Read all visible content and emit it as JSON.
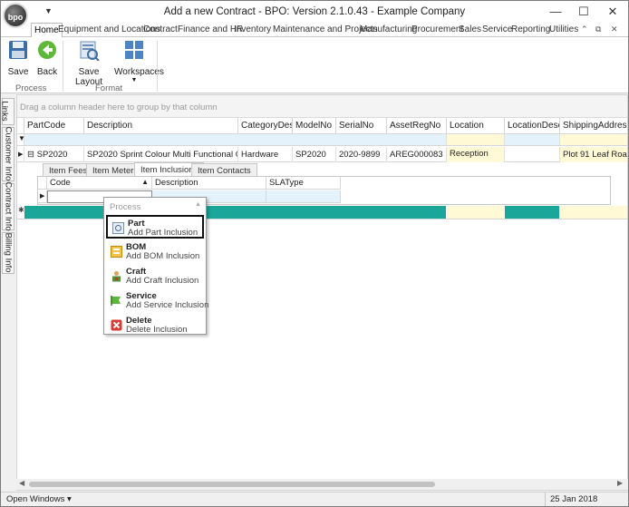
{
  "window": {
    "title": "Add a new Contract - BPO: Version 2.1.0.43 - Example Company",
    "logo_text": "bpo",
    "minimize": "—",
    "maximize": "☐",
    "close": "✕"
  },
  "menu": {
    "tabs": [
      "Home",
      "Equipment and Locations",
      "Contract",
      "Finance and HR",
      "Inventory",
      "Maintenance and Projects",
      "Manufacturing",
      "Procurement",
      "Sales",
      "Service",
      "Reporting",
      "Utilities"
    ],
    "active": "Home"
  },
  "ribbon": {
    "save": "Save",
    "back": "Back",
    "save_layout": "Save Layout",
    "workspaces": "Workspaces",
    "group_process": "Process",
    "group_format": "Format"
  },
  "side_tabs": [
    "Links",
    "Customer Info",
    "Contract Info",
    "Billing Info"
  ],
  "grid": {
    "group_hint": "Drag a column header here to group by that column",
    "columns": [
      "PartCode",
      "Description",
      "CategoryDesc",
      "ModelNo",
      "SerialNo",
      "AssetRegNo",
      "Location",
      "LocationDesc",
      "ShippingAddress"
    ],
    "row": {
      "expander": "⊟",
      "partcode": "SP2020",
      "description": "SP2020 Sprint Colour Multi Functional Copier",
      "category": "Hardware",
      "model": "SP2020",
      "serial": "2020-9899",
      "asset": "AREG000083",
      "location": "Reception",
      "location_desc": "",
      "shipping": "Plot 91 Leaf Road, Fo"
    }
  },
  "detail": {
    "tabs": [
      "Item Fees",
      "Item Meters",
      "Item Inclusions",
      "Item Contacts"
    ],
    "active_tab": "Item Inclusions",
    "columns": [
      "Code",
      "Description",
      "SLAType"
    ]
  },
  "context_menu": {
    "header": "Process",
    "items": [
      {
        "title": "Part",
        "subtitle": "Add Part Inclusion",
        "icon": "part-icon"
      },
      {
        "title": "BOM",
        "subtitle": "Add BOM Inclusion",
        "icon": "bom-icon"
      },
      {
        "title": "Craft",
        "subtitle": "Add Craft Inclusion",
        "icon": "craft-icon"
      },
      {
        "title": "Service",
        "subtitle": "Add Service Inclusion",
        "icon": "service-icon"
      },
      {
        "title": "Delete",
        "subtitle": "Delete Inclusion",
        "icon": "delete-icon"
      }
    ]
  },
  "status": {
    "open_windows": "Open Windows ▾",
    "date": "25 Jan 2018"
  },
  "colors": {
    "teal": "#1aa79a",
    "yellow_col": "#fff9d6",
    "filter_blue": "#e4f3fb"
  }
}
